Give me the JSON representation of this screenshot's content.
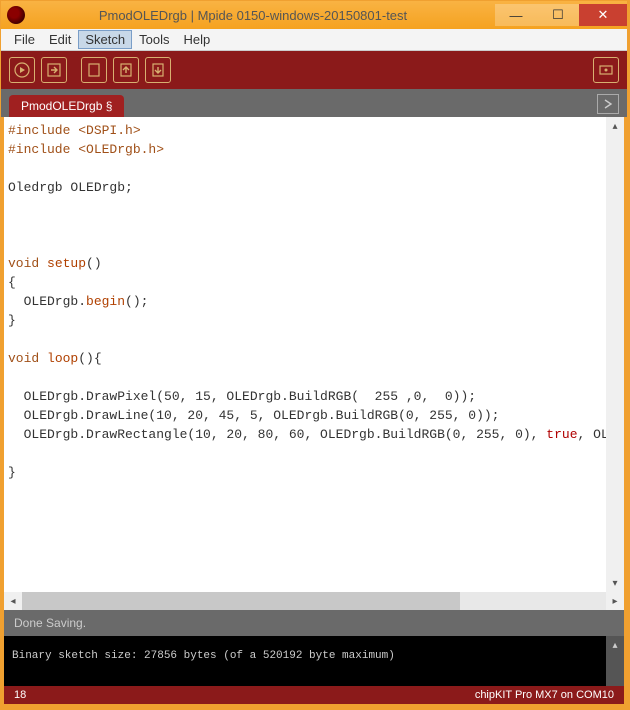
{
  "window": {
    "title": "PmodOLEDrgb | Mpide 0150-windows-20150801-test"
  },
  "menubar": {
    "items": [
      "File",
      "Edit",
      "Sketch",
      "Tools",
      "Help"
    ],
    "active_index": 2
  },
  "tab": {
    "label": "PmodOLEDrgb §"
  },
  "editor": {
    "lines": [
      {
        "segments": [
          {
            "t": "#include <DSPI.h>",
            "c": "kw"
          }
        ]
      },
      {
        "segments": [
          {
            "t": "#include <OLEDrgb.h>",
            "c": "kw"
          }
        ]
      },
      {
        "segments": [
          {
            "t": "",
            "c": ""
          }
        ]
      },
      {
        "segments": [
          {
            "t": "Oledrgb OLEDrgb;",
            "c": ""
          }
        ]
      },
      {
        "segments": [
          {
            "t": "",
            "c": ""
          }
        ]
      },
      {
        "segments": [
          {
            "t": "",
            "c": ""
          }
        ]
      },
      {
        "segments": [
          {
            "t": "",
            "c": ""
          }
        ]
      },
      {
        "segments": [
          {
            "t": "void ",
            "c": "kw"
          },
          {
            "t": "setup",
            "c": "fn"
          },
          {
            "t": "()",
            "c": ""
          }
        ]
      },
      {
        "segments": [
          {
            "t": "{",
            "c": ""
          }
        ]
      },
      {
        "segments": [
          {
            "t": "  OLEDrgb.",
            "c": ""
          },
          {
            "t": "begin",
            "c": "fn"
          },
          {
            "t": "();",
            "c": ""
          }
        ]
      },
      {
        "segments": [
          {
            "t": "}",
            "c": ""
          }
        ]
      },
      {
        "segments": [
          {
            "t": "",
            "c": ""
          }
        ]
      },
      {
        "segments": [
          {
            "t": "void ",
            "c": "kw"
          },
          {
            "t": "loop",
            "c": "fn"
          },
          {
            "t": "(){",
            "c": ""
          }
        ]
      },
      {
        "segments": [
          {
            "t": "",
            "c": ""
          }
        ]
      },
      {
        "segments": [
          {
            "t": "  OLEDrgb.DrawPixel(50, 15, OLEDrgb.BuildRGB(  255 ,0,  0));",
            "c": ""
          }
        ]
      },
      {
        "segments": [
          {
            "t": "  OLEDrgb.DrawLine(10, 20, 45, 5, OLEDrgb.BuildRGB(0, 255, 0));",
            "c": ""
          }
        ]
      },
      {
        "segments": [
          {
            "t": "  OLEDrgb.DrawRectangle(10, 20, 80, 60, OLEDrgb.BuildRGB(0, 255, 0), ",
            "c": ""
          },
          {
            "t": "true",
            "c": "lit"
          },
          {
            "t": ", OLEDrgb.Bu",
            "c": ""
          }
        ]
      },
      {
        "segments": [
          {
            "t": "",
            "c": ""
          }
        ]
      },
      {
        "segments": [
          {
            "t": "}",
            "c": ""
          }
        ]
      }
    ]
  },
  "status": {
    "message": "Done Saving."
  },
  "console": {
    "text": "Binary sketch size: 27856 bytes (of a 520192 byte maximum)"
  },
  "footer": {
    "line_number": "18",
    "board_info": "chipKIT Pro MX7 on COM10"
  }
}
